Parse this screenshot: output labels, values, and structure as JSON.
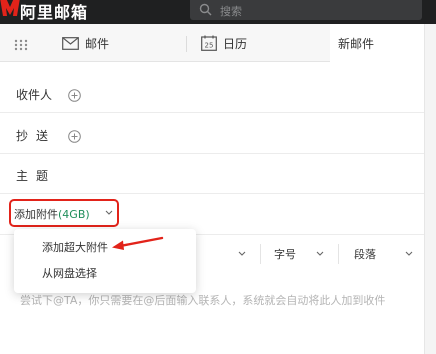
{
  "header": {
    "logo_text": "阿里邮箱",
    "search_placeholder": "搜索"
  },
  "tabs": {
    "mail_label": "邮件",
    "calendar_label": "日历",
    "calendar_day": "25",
    "new_mail_label": "新邮件"
  },
  "form": {
    "to_label": "收件人",
    "cc_label": "抄送",
    "subject_label": "主题"
  },
  "attachment": {
    "label": "添加附件",
    "size": "(4GB)"
  },
  "dropdown": {
    "items": [
      "添加超大附件",
      "从网盘选择"
    ]
  },
  "toolbar": {
    "font_size_label": "字号",
    "paragraph_label": "段落"
  },
  "editor": {
    "hint": "尝试下@TA，你只需要在@后面输入联系人，系统就会自动将此人加到收件"
  },
  "colors": {
    "accent_red": "#e2231a",
    "header_bg": "#1f2021",
    "size_green": "#1e8e5a"
  }
}
